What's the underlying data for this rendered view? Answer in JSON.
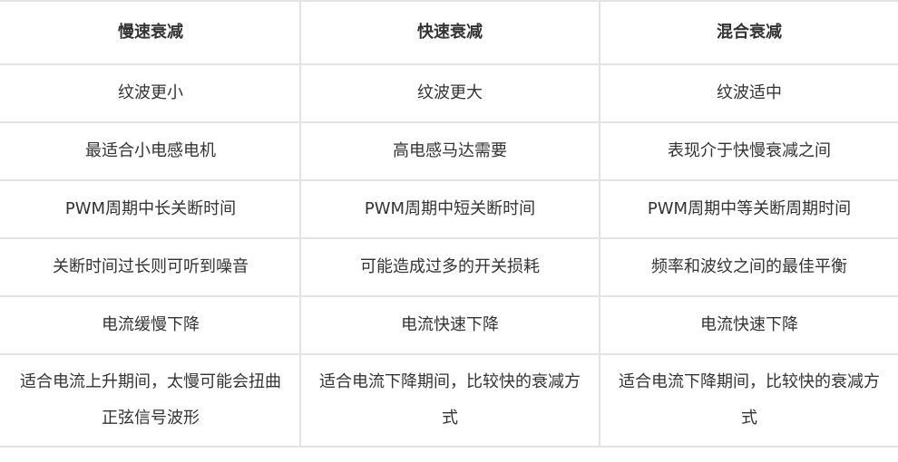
{
  "table": {
    "headers": [
      "慢速衰减",
      "快速衰减",
      "混合衰减"
    ],
    "rows": [
      [
        "纹波更小",
        "纹波更大",
        "纹波适中"
      ],
      [
        "最适合小电感电机",
        "高电感马达需要",
        "表现介于快慢衰减之间"
      ],
      [
        "PWM周期中长关断时间",
        "PWM周期中短关断时间",
        "PWM周期中等关断周期时间"
      ],
      [
        "关断时间过长则可听到噪音",
        "可能造成过多的开关损耗",
        "频率和波纹之间的最佳平衡"
      ],
      [
        "电流缓慢下降",
        "电流快速下降",
        "电流快速下降"
      ],
      [
        "适合电流上升期间，太慢可能会扭曲正弦信号波形",
        "适合电流下降期间，比较快的衰减方式",
        "适合电流下降期间，比较快的衰减方式"
      ]
    ]
  }
}
